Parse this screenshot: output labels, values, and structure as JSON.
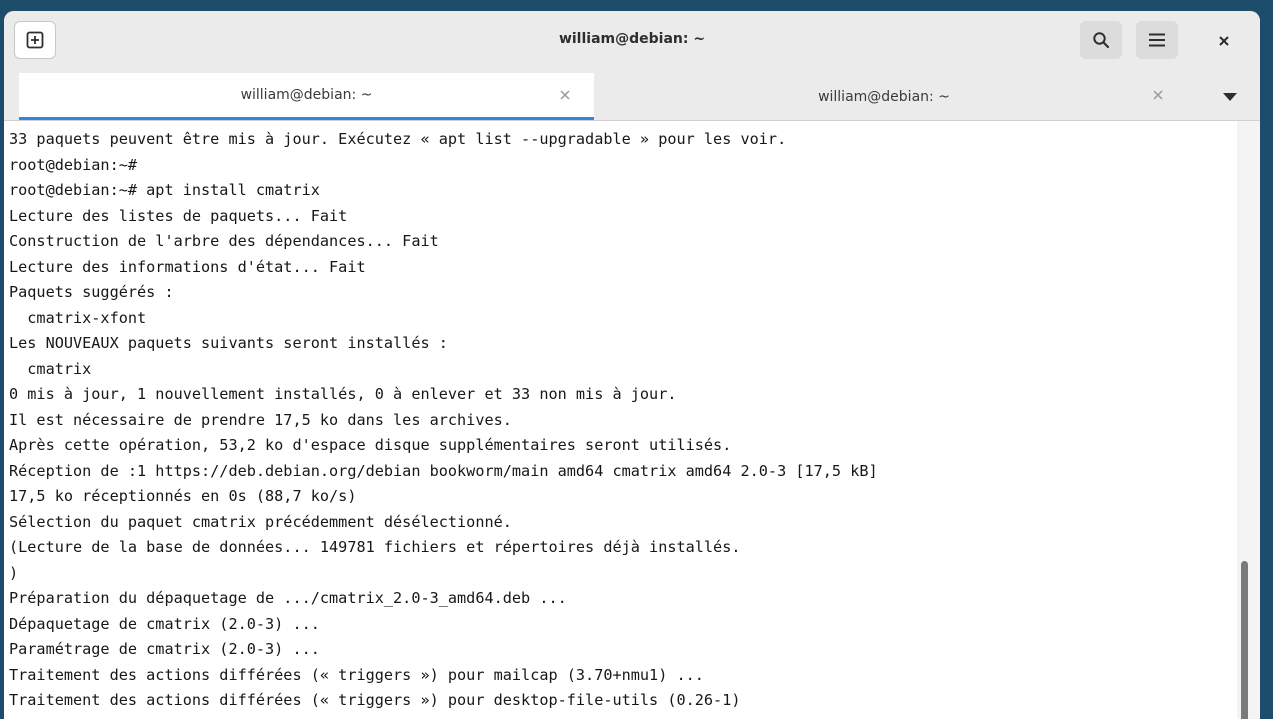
{
  "window": {
    "title": "william@debian: ~"
  },
  "headerbar": {
    "new_tab_icon": "plus-box-icon",
    "search_icon": "search-icon",
    "menu_icon": "hamburger-menu-icon",
    "close_icon": "close-icon"
  },
  "tabs": [
    {
      "label": "william@debian: ~",
      "active": true
    },
    {
      "label": "william@debian: ~",
      "active": false
    }
  ],
  "colors": {
    "accent": "#3584e4",
    "background": "#ffffff",
    "text": "#171717"
  },
  "terminal": {
    "lines": [
      "33 paquets peuvent être mis à jour. Exécutez « apt list --upgradable » pour les voir.",
      "root@debian:~#",
      "root@debian:~# apt install cmatrix",
      "Lecture des listes de paquets... Fait",
      "Construction de l'arbre des dépendances... Fait",
      "Lecture des informations d'état... Fait",
      "Paquets suggérés :",
      "  cmatrix-xfont",
      "Les NOUVEAUX paquets suivants seront installés :",
      "  cmatrix",
      "0 mis à jour, 1 nouvellement installés, 0 à enlever et 33 non mis à jour.",
      "Il est nécessaire de prendre 17,5 ko dans les archives.",
      "Après cette opération, 53,2 ko d'espace disque supplémentaires seront utilisés.",
      "Réception de :1 https://deb.debian.org/debian bookworm/main amd64 cmatrix amd64 2.0-3 [17,5 kB]",
      "17,5 ko réceptionnés en 0s (88,7 ko/s)",
      "Sélection du paquet cmatrix précédemment désélectionné.",
      "(Lecture de la base de données... 149781 fichiers et répertoires déjà installés.",
      ")",
      "Préparation du dépaquetage de .../cmatrix_2.0-3_amd64.deb ...",
      "Dépaquetage de cmatrix (2.0-3) ...",
      "Paramétrage de cmatrix (2.0-3) ...",
      "Traitement des actions différées (« triggers ») pour mailcap (3.70+nmu1) ...",
      "Traitement des actions différées (« triggers ») pour desktop-file-utils (0.26-1)"
    ]
  }
}
